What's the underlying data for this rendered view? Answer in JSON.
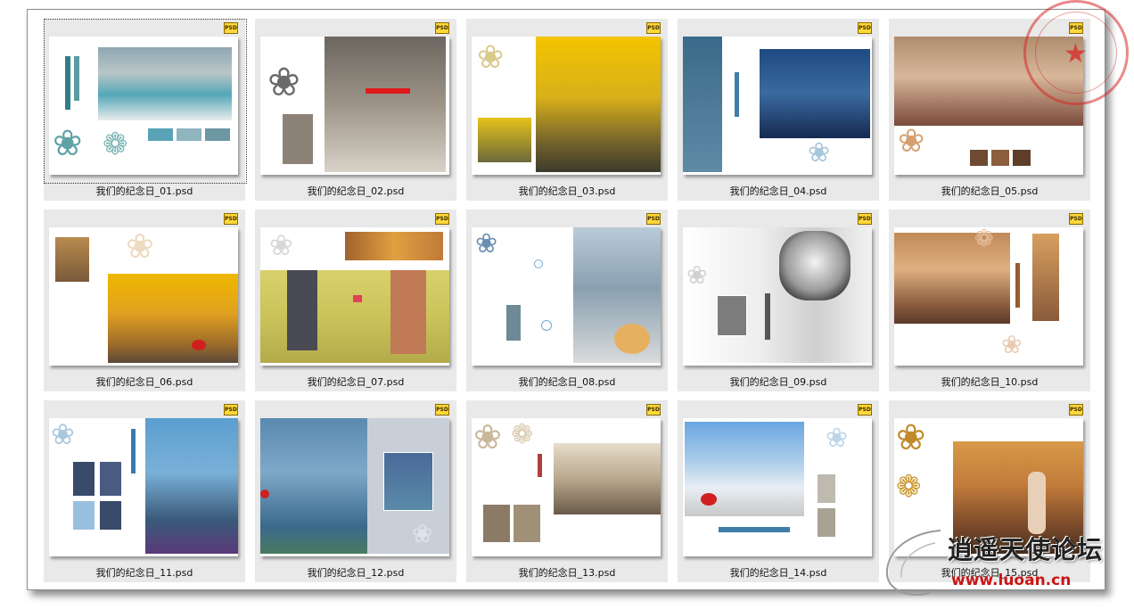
{
  "badge_label": "PSD",
  "colors": {
    "stamp_red": "#d72828",
    "watermark_url_red": "#cc1515",
    "tile_bg": "#e9e9e9"
  },
  "files": [
    {
      "name": "我们的纪念日_01.psd",
      "selected": true
    },
    {
      "name": "我们的纪念日_02.psd",
      "selected": false
    },
    {
      "name": "我们的纪念日_03.psd",
      "selected": false
    },
    {
      "name": "我们的纪念日_04.psd",
      "selected": false
    },
    {
      "name": "我们的纪念日_05.psd",
      "selected": false
    },
    {
      "name": "我们的纪念日_06.psd",
      "selected": false
    },
    {
      "name": "我们的纪念日_07.psd",
      "selected": false
    },
    {
      "name": "我们的纪念日_08.psd",
      "selected": false
    },
    {
      "name": "我们的纪念日_09.psd",
      "selected": false
    },
    {
      "name": "我们的纪念日_10.psd",
      "selected": false
    },
    {
      "name": "我们的纪念日_11.psd",
      "selected": false
    },
    {
      "name": "我们的纪念日_12.psd",
      "selected": false
    },
    {
      "name": "我们的纪念日_13.psd",
      "selected": false
    },
    {
      "name": "我们的纪念日_14.psd",
      "selected": false
    },
    {
      "name": "我们的纪念日_15.psd",
      "selected": false
    }
  ],
  "watermark": {
    "title": "逍遥天使论坛",
    "url": "www.luoan.cn"
  }
}
